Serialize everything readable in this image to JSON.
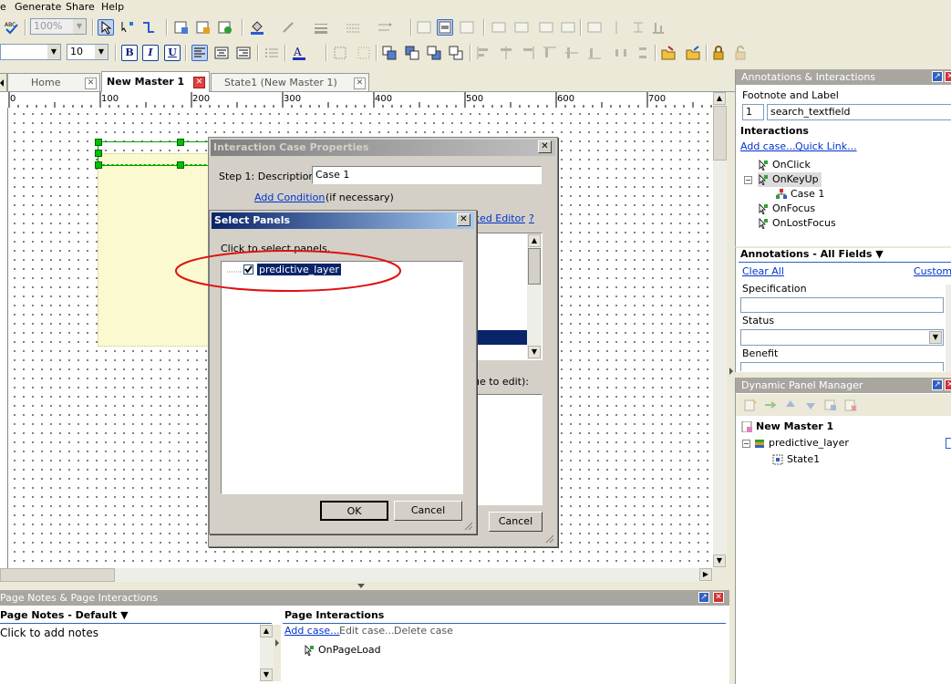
{
  "menu": {
    "items": [
      "e",
      "Generate",
      "Share",
      "Help"
    ]
  },
  "toolbar1": {
    "zoom": "100%"
  },
  "toolbar2": {
    "font_size": "10",
    "bold": "B",
    "italic": "I",
    "underline": "U"
  },
  "tabs": [
    {
      "label": "Home"
    },
    {
      "label": "New Master 1"
    },
    {
      "label": "State1 (New Master 1)"
    }
  ],
  "ruler": {
    "labels": [
      "0",
      "100",
      "200",
      "300",
      "400",
      "500",
      "600",
      "700"
    ]
  },
  "interaction_dialog": {
    "title": "Interaction Case Properties",
    "step1_label": "Step 1: Description",
    "description_value": "Case 1",
    "add_condition": "Add Condition",
    "if_necessary": "(if necessary)",
    "advanced_editor": "ced Editor",
    "help": "?",
    "value_hint": "lue to edit):",
    "cancel": "Cancel"
  },
  "select_panels_dialog": {
    "title": "Select Panels",
    "instruction": "Click to select panels.",
    "item": "predictive_layer",
    "ok": "OK",
    "cancel": "Cancel"
  },
  "annotations_panel": {
    "title": "Annotations & Interactions",
    "footnote_label": "Footnote and Label",
    "footnote_number": "1",
    "label_value": "search_textfield",
    "interactions_heading": "Interactions",
    "add_case": "Add case...",
    "quick_link": "Quick Link...",
    "events": [
      {
        "label": "OnClick"
      },
      {
        "label": "OnKeyUp"
      },
      {
        "label": "Case 1"
      },
      {
        "label": "OnFocus"
      },
      {
        "label": "OnLostFocus"
      }
    ]
  },
  "annotation_fields": {
    "title": "Annotations - All Fields",
    "clear_all": "Clear All",
    "customize": "Customiz",
    "specification": "Specification",
    "status": "Status",
    "benefit": "Benefit"
  },
  "dynamic_panel_manager": {
    "title": "Dynamic Panel Manager",
    "master": "New Master 1",
    "panel": "predictive_layer",
    "state": "State1"
  },
  "page_notes": {
    "title": "Page Notes & Page Interactions",
    "notes_heading": "Page Notes - Default",
    "notes_placeholder": "Click to add notes",
    "interactions_heading": "Page Interactions",
    "add_case": "Add case...",
    "edit_case": "Edit case...",
    "delete_case": "Delete case",
    "event": "OnPageLoad"
  },
  "colors": {
    "accent_blue": "#0a246a",
    "panel_header": "#a9a6a0",
    "highlight_ellipse": "#e01010",
    "selection_green": "#00c000",
    "panel_yellow": "#fbf9d0"
  }
}
